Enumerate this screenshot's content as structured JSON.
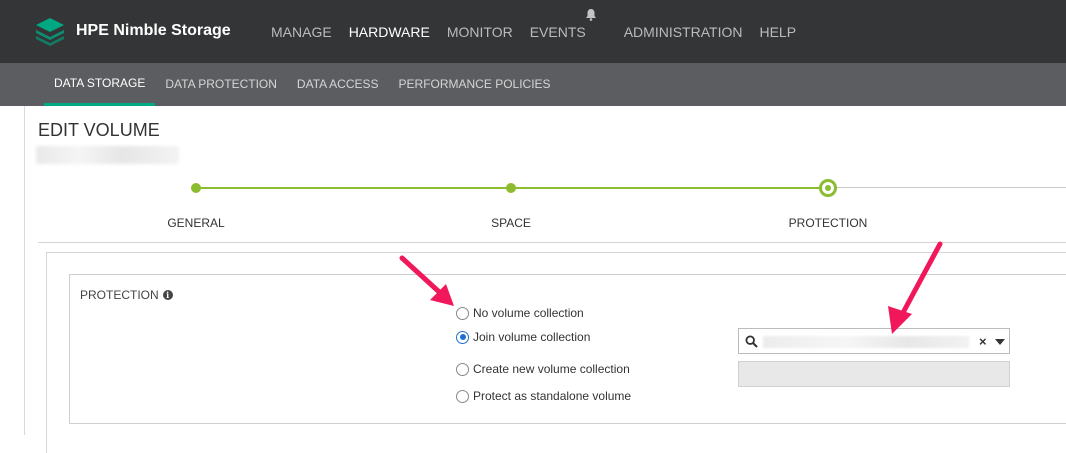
{
  "app": {
    "brand": "HPE Nimble Storage",
    "accent": "#01a982"
  },
  "topnav": {
    "items": [
      "MANAGE",
      "HARDWARE",
      "MONITOR",
      "EVENTS",
      "ADMINISTRATION",
      "HELP"
    ],
    "active": "HARDWARE"
  },
  "subnav": {
    "items": [
      "DATA STORAGE",
      "DATA PROTECTION",
      "DATA ACCESS",
      "PERFORMANCE POLICIES"
    ],
    "active": "DATA STORAGE"
  },
  "page": {
    "title": "EDIT VOLUME"
  },
  "wizard": {
    "steps": [
      "GENERAL",
      "SPACE",
      "PROTECTION"
    ],
    "current": "PROTECTION",
    "color": "#8cbc2f"
  },
  "protection": {
    "label": "PROTECTION",
    "info_icon": "info-icon",
    "options": [
      "No volume collection",
      "Join volume collection",
      "Create new volume collection",
      "Protect as standalone volume"
    ],
    "selected": "Join volume collection"
  },
  "collection_select": {
    "clear_glyph": "×",
    "search_icon": "search-icon",
    "caret_icon": "chevron-down-icon"
  },
  "annotation": {
    "arrow_color": "#f0185a"
  }
}
